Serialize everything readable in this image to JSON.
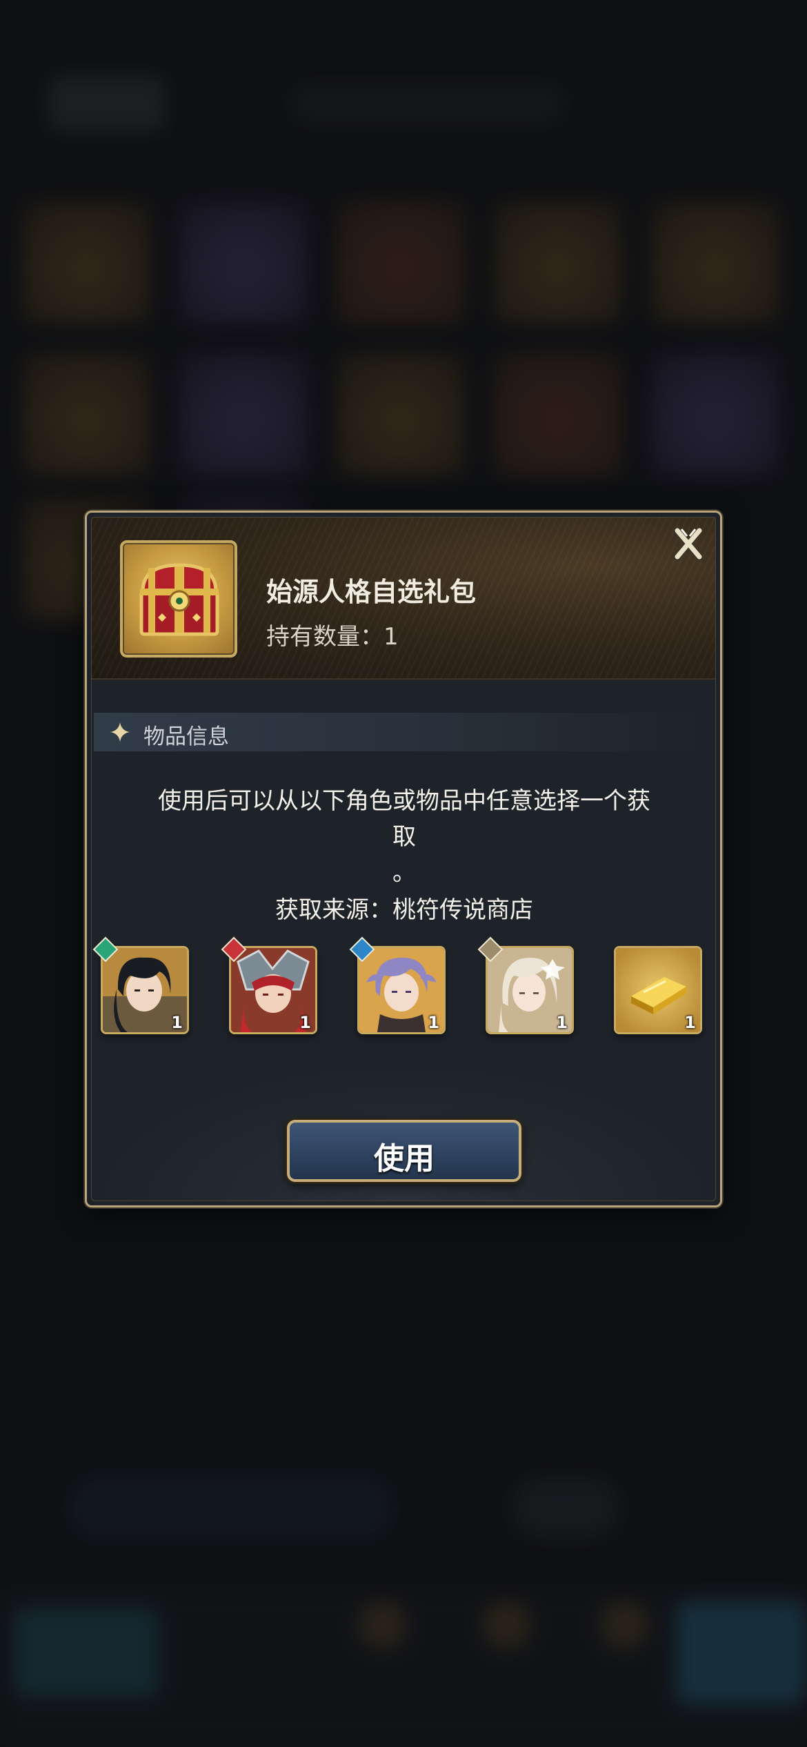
{
  "dialog": {
    "item_name": "始源人格自选礼包",
    "count_label": "持有数量：",
    "count_value": "1",
    "section_title": "物品信息",
    "description_line1": "使用后可以从以下角色或物品中任意选择一个获",
    "description_line2": "取",
    "description_line3": "。",
    "source_line": "获取来源：桃符传说商店",
    "use_button_label": "使用"
  },
  "rewards": [
    {
      "quantity": "1",
      "element_color": "#2aa57a",
      "icon": "character-portrait-icon"
    },
    {
      "quantity": "1",
      "element_color": "#c8343a",
      "icon": "character-portrait-icon"
    },
    {
      "quantity": "1",
      "element_color": "#2c86c8",
      "icon": "character-portrait-icon"
    },
    {
      "quantity": "1",
      "element_color": "#9c8c6c",
      "icon": "character-portrait-icon"
    },
    {
      "quantity": "1",
      "icon": "gold-bar-icon"
    }
  ],
  "colors": {
    "accent_gold": "#c6a960",
    "button_blue": "#2e4360",
    "panel_bg": "#1e2329"
  }
}
